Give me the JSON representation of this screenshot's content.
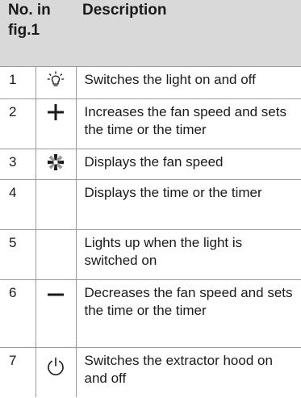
{
  "table": {
    "header": {
      "number": "No. in fig.1",
      "description": "Description"
    },
    "rows": [
      {
        "number": "1",
        "icon": "light-bulb-icon",
        "description": "Switches the light on and off"
      },
      {
        "number": "2",
        "icon": "plus-icon",
        "description": "Increases the fan speed and sets the time or the timer"
      },
      {
        "number": "3",
        "icon": "fan-icon",
        "description": "Displays the fan speed"
      },
      {
        "number": "4",
        "icon": "",
        "description": "Displays the time or the timer"
      },
      {
        "number": "5",
        "icon": "",
        "description": "Lights up when the light is switched on"
      },
      {
        "number": "6",
        "icon": "minus-icon",
        "description": "Decreases the fan speed and sets the time or the timer"
      },
      {
        "number": "7",
        "icon": "power-icon",
        "description": "Switches the extractor hood on and off"
      }
    ]
  },
  "colors": {
    "header_bg": "#d9d9d9",
    "rule": "#9a9a9a",
    "text": "#1a1a1a"
  }
}
